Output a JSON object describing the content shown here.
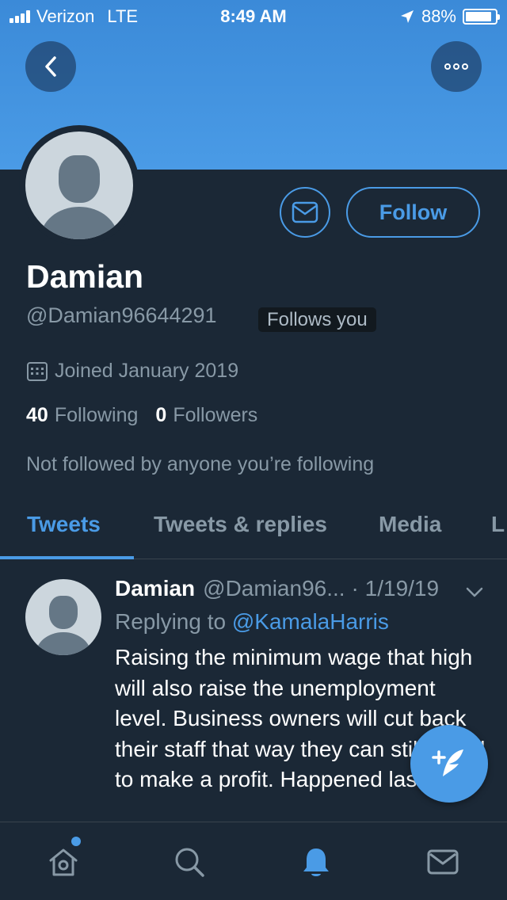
{
  "status_bar": {
    "carrier": "Verizon",
    "network": "LTE",
    "time": "8:49 AM",
    "battery": "88%",
    "battery_level": 0.88
  },
  "header": {
    "back_icon": "chevron-left-icon",
    "more_icon": "more-horizontal-icon"
  },
  "profile": {
    "display_name": "Damian",
    "handle": "@Damian96644291",
    "follows_you": "Follows you",
    "joined": "Joined January 2019",
    "following_count": "40",
    "following_label": "Following",
    "followers_count": "0",
    "followers_label": "Followers",
    "not_followed": "Not followed by anyone you’re following",
    "follow_label": "Follow"
  },
  "tabs": [
    {
      "label": "Tweets",
      "active": true
    },
    {
      "label": "Tweets & replies",
      "active": false
    },
    {
      "label": "Media",
      "active": false
    },
    {
      "label": "L",
      "active": false
    }
  ],
  "tweet": {
    "author": "Damian",
    "handle": "@Damian96...",
    "date": "· 1/19/19",
    "replying_to_label": "Replying to",
    "replying_to_mention": "@KamalaHarris",
    "text": "Raising the minimum wage that high will also raise the unemployment level. Business owners will cut back their staff that way they can still afford to make a profit. Happened last time"
  },
  "bottom_nav": [
    "home-icon",
    "search-icon",
    "notifications-icon",
    "messages-icon"
  ],
  "colors": {
    "accent": "#4a9be6",
    "background": "#1b2836",
    "muted_text": "#8899a6"
  }
}
